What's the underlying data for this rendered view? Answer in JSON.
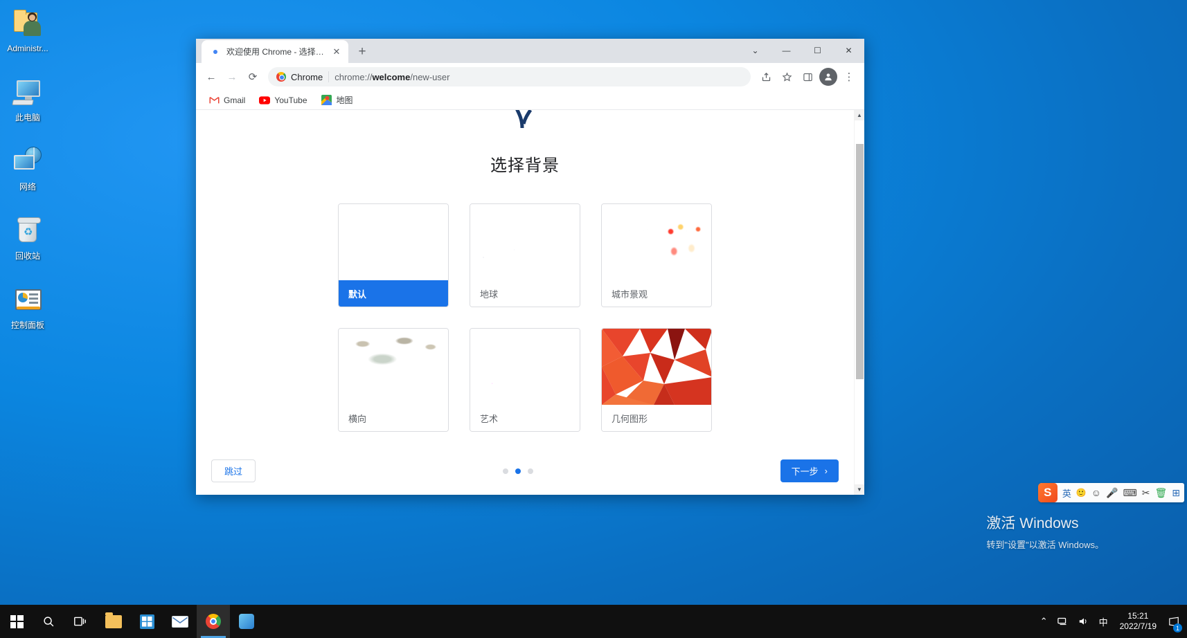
{
  "desktop": {
    "icons": [
      {
        "label": "Administr...",
        "icon": "user-folder-icon"
      },
      {
        "label": "此电脑",
        "icon": "this-pc-icon"
      },
      {
        "label": "网络",
        "icon": "network-icon"
      },
      {
        "label": "回收站",
        "icon": "recycle-bin-icon"
      },
      {
        "label": "控制面板",
        "icon": "control-panel-icon"
      }
    ],
    "watermark": {
      "title": "激活 Windows",
      "subtitle": "转到\"设置\"以激活 Windows。"
    }
  },
  "browser": {
    "tab": {
      "title": "欢迎使用 Chrome - 选择背景",
      "favicon": "chrome-icon",
      "close": "✕"
    },
    "new_tab_label": "+",
    "window_controls": {
      "minimize": "—",
      "maximize": "☐",
      "close": "✕",
      "more": "⌄"
    },
    "nav": {
      "back": "←",
      "forward": "→",
      "reload": "⟳"
    },
    "omnibox": {
      "site_label": "Chrome",
      "url_prefix": "chrome://",
      "url_bold": "welcome",
      "url_suffix": "/new-user",
      "full_url": "chrome://welcome/new-user",
      "share": "share-icon",
      "bookmark": "star-icon",
      "sidepanel": "side-panel-icon",
      "profile": "profile-avatar-icon",
      "menu": "⋮"
    },
    "bookmarks": [
      {
        "label": "Gmail",
        "icon": "gmail-icon"
      },
      {
        "label": "YouTube",
        "icon": "youtube-icon"
      },
      {
        "label": "地图",
        "icon": "google-maps-icon"
      }
    ]
  },
  "welcome_page": {
    "title": "选择背景",
    "cards": [
      {
        "label": "默认",
        "thumb": "th-default",
        "selected": true
      },
      {
        "label": "地球",
        "thumb": "th-earth",
        "selected": false
      },
      {
        "label": "城市景观",
        "thumb": "th-city",
        "selected": false
      },
      {
        "label": "横向",
        "thumb": "th-landscape",
        "selected": false
      },
      {
        "label": "艺术",
        "thumb": "th-art",
        "selected": false
      },
      {
        "label": "几何图形",
        "thumb": "th-geo",
        "selected": false
      }
    ],
    "footer": {
      "skip_label": "跳过",
      "next_label": "下一步",
      "next_arrow": "›",
      "dots_total": 3,
      "dot_active_index": 1
    },
    "accent_color": "#1a73e8"
  },
  "ime": {
    "logo": "S",
    "mode": "英",
    "items": [
      "🙂",
      "🎤",
      "⌨",
      "✂",
      "🗑",
      "⊞"
    ]
  },
  "taskbar": {
    "start": "windows-start-icon",
    "items": [
      {
        "name": "search-icon",
        "glyph": "search"
      },
      {
        "name": "task-view-icon",
        "glyph": "taskview"
      },
      {
        "name": "file-explorer-icon",
        "glyph": "folder"
      },
      {
        "name": "microsoft-store-icon",
        "glyph": "store"
      },
      {
        "name": "mail-icon",
        "glyph": "mail"
      },
      {
        "name": "chrome-taskbar-icon",
        "glyph": "chrome",
        "active": true
      },
      {
        "name": "paint-icon",
        "glyph": "paint"
      }
    ],
    "tray": {
      "chevron": "⌃",
      "network": "network-tray-icon",
      "volume": "volume-icon",
      "ime": "中"
    },
    "clock": {
      "time": "15:21",
      "date": "2022/7/19"
    },
    "action_center_badge": "1"
  }
}
